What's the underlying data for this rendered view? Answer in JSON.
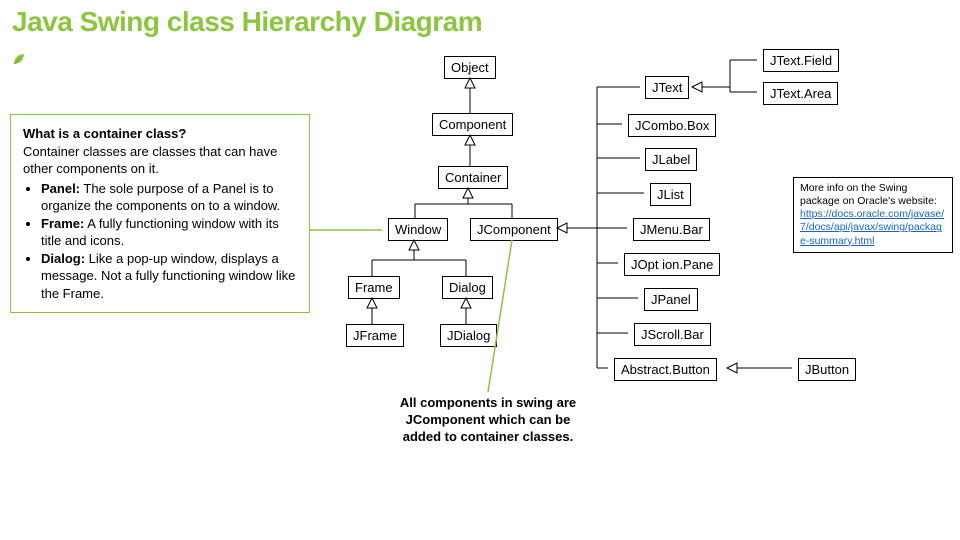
{
  "title": "Java Swing class Hierarchy Diagram",
  "nodes": {
    "object": "Object",
    "component": "Component",
    "container": "Container",
    "window": "Window",
    "jcomponent": "JComponent",
    "frame": "Frame",
    "dialog": "Dialog",
    "jframe": "JFrame",
    "jdialog": "JDialog",
    "jtext": "JText",
    "jtextfield": "JText.Field",
    "jtextarea": "JText.Area",
    "jcombobox": "JCombo.Box",
    "jlabel": "JLabel",
    "jlist": "JList",
    "jmenubar": "JMenu.Bar",
    "joptionpane": "JOpt ion.Pane",
    "jpanel": "JPanel",
    "jscrollbar": "JScroll.Bar",
    "abstractbutton": "Abstract.Button",
    "jbutton": "JButton"
  },
  "sidebox": {
    "q": "What is a container class?",
    "intro": "Container classes are classes that can have other components on it.",
    "items": [
      {
        "term": "Panel:",
        "desc": " The sole purpose of a Panel is to organize the components on to a window."
      },
      {
        "term": "Frame:",
        "desc": " A fully functioning window with its title and icons."
      },
      {
        "term": "Dialog:",
        "desc": " Like a pop-up window, displays a message. Not a fully functioning window like the Frame."
      }
    ]
  },
  "note": "All components in swing are JComponent which can be added to container classes.",
  "moreinfo": {
    "text": "More info on the Swing package on Oracle's website:",
    "link_text": "https://docs.oracle.com/javase/7/docs/api/javax/swing/package-summary.html"
  }
}
